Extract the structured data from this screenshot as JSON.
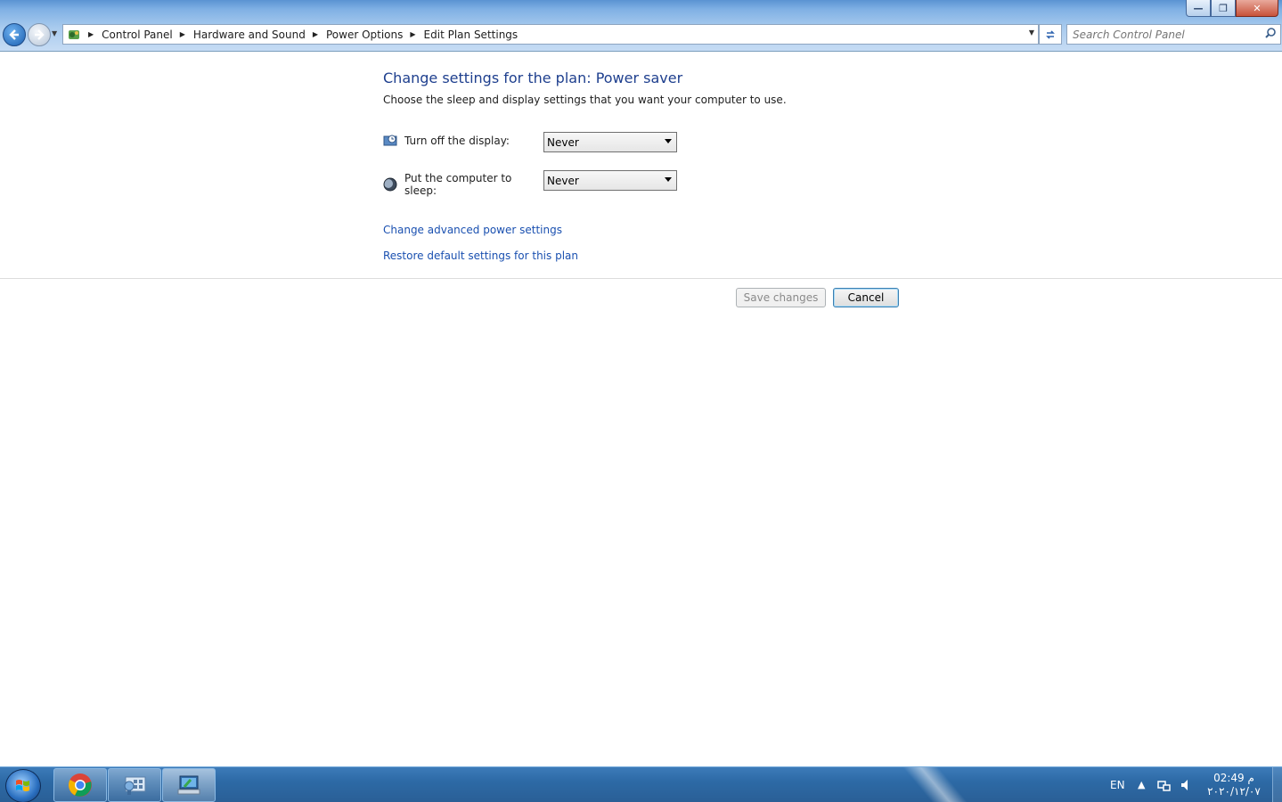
{
  "window": {
    "minimize_symbol": "—",
    "restore_symbol": "❐",
    "close_symbol": "✕"
  },
  "address_bar": {
    "breadcrumbs": [
      "Control Panel",
      "Hardware and Sound",
      "Power Options",
      "Edit Plan Settings"
    ]
  },
  "search": {
    "placeholder": "Search Control Panel"
  },
  "main": {
    "title": "Change settings for the plan: Power saver",
    "subtitle": "Choose the sleep and display settings that you want your computer to use.",
    "settings": [
      {
        "label": "Turn off the display:",
        "value": "Never",
        "icon": "display-clock-icon"
      },
      {
        "label": "Put the computer to sleep:",
        "value": "Never",
        "icon": "sleep-moon-icon"
      }
    ],
    "links": {
      "advanced": "Change advanced power settings",
      "restore": "Restore default settings for this plan"
    },
    "buttons": {
      "save": "Save changes",
      "cancel": "Cancel"
    }
  },
  "taskbar": {
    "pinned": [
      "chrome-icon",
      "control-panel-icon",
      "power-options-icon"
    ],
    "language": "EN",
    "clock_time": "02:49 م",
    "clock_date": "٢٠٢٠/١٢/٠٧"
  }
}
